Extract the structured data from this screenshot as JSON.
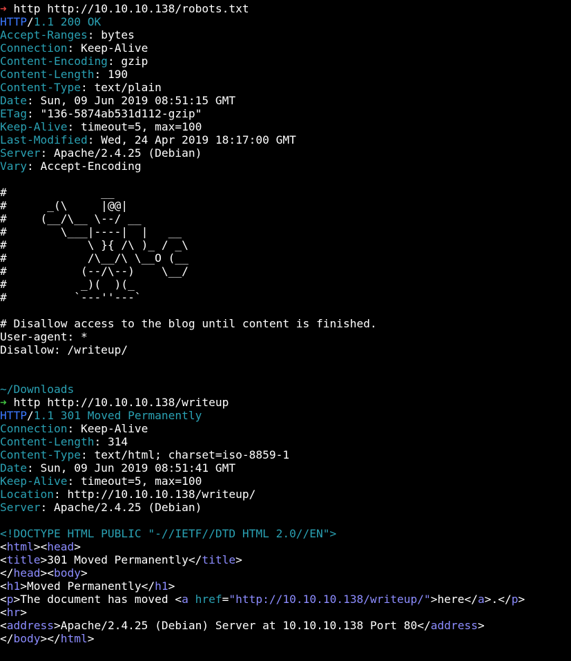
{
  "theme": {
    "background": "#000000",
    "foreground": "#ffffff",
    "blue": "#3b78ff",
    "teal": "#2aa1b3",
    "red_prompt": "#e0433f",
    "green_prompt": "#40c040",
    "purple": "#8c8cff"
  },
  "prompt_icon": "prompt-arrow-icon",
  "lines": [
    {
      "segs": [
        {
          "t": "➜",
          "c": "red"
        },
        {
          "t": " http http://10.10.10.138/robots.txt",
          "c": "white"
        }
      ]
    },
    {
      "segs": [
        {
          "t": "HTTP",
          "c": "blue"
        },
        {
          "t": "/",
          "c": "white"
        },
        {
          "t": "1.1 200 OK",
          "c": "teal"
        }
      ]
    },
    {
      "segs": [
        {
          "t": "Accept-Ranges",
          "c": "teal"
        },
        {
          "t": ": bytes",
          "c": "white"
        }
      ]
    },
    {
      "segs": [
        {
          "t": "Connection",
          "c": "teal"
        },
        {
          "t": ": Keep-Alive",
          "c": "white"
        }
      ]
    },
    {
      "segs": [
        {
          "t": "Content-Encoding",
          "c": "teal"
        },
        {
          "t": ": gzip",
          "c": "white"
        }
      ]
    },
    {
      "segs": [
        {
          "t": "Content-Length",
          "c": "teal"
        },
        {
          "t": ": 190",
          "c": "white"
        }
      ]
    },
    {
      "segs": [
        {
          "t": "Content-Type",
          "c": "teal"
        },
        {
          "t": ": text/plain",
          "c": "white"
        }
      ]
    },
    {
      "segs": [
        {
          "t": "Date",
          "c": "teal"
        },
        {
          "t": ": Sun, 09 Jun 2019 08:51:15 GMT",
          "c": "white"
        }
      ]
    },
    {
      "segs": [
        {
          "t": "ETag",
          "c": "teal"
        },
        {
          "t": ": \"136-5874ab531d112-gzip\"",
          "c": "white"
        }
      ]
    },
    {
      "segs": [
        {
          "t": "Keep-Alive",
          "c": "teal"
        },
        {
          "t": ": timeout=5, max=100",
          "c": "white"
        }
      ]
    },
    {
      "segs": [
        {
          "t": "Last-Modified",
          "c": "teal"
        },
        {
          "t": ": Wed, 24 Apr 2019 18:17:00 GMT",
          "c": "white"
        }
      ]
    },
    {
      "segs": [
        {
          "t": "Server",
          "c": "teal"
        },
        {
          "t": ": Apache/2.4.25 (Debian)",
          "c": "white"
        }
      ]
    },
    {
      "segs": [
        {
          "t": "Vary",
          "c": "teal"
        },
        {
          "t": ": Accept-Encoding",
          "c": "white"
        }
      ]
    },
    {
      "segs": []
    },
    {
      "segs": [
        {
          "t": "#              __",
          "c": "white"
        }
      ]
    },
    {
      "segs": [
        {
          "t": "#      _(\\     |@@|",
          "c": "white"
        }
      ]
    },
    {
      "segs": [
        {
          "t": "#     (__/\\__ \\--/ __",
          "c": "white"
        }
      ]
    },
    {
      "segs": [
        {
          "t": "#        \\___|----|  |   __",
          "c": "white"
        }
      ]
    },
    {
      "segs": [
        {
          "t": "#            \\ }{ /\\ )_ / _\\",
          "c": "white"
        }
      ]
    },
    {
      "segs": [
        {
          "t": "#            /\\__/\\ \\__O (__",
          "c": "white"
        }
      ]
    },
    {
      "segs": [
        {
          "t": "#           (--/\\--)    \\__/",
          "c": "white"
        }
      ]
    },
    {
      "segs": [
        {
          "t": "#           _)(  )(_",
          "c": "white"
        }
      ]
    },
    {
      "segs": [
        {
          "t": "#          `---''---`",
          "c": "white"
        }
      ]
    },
    {
      "segs": []
    },
    {
      "segs": [
        {
          "t": "# Disallow access to the blog until content is finished.",
          "c": "white"
        }
      ]
    },
    {
      "segs": [
        {
          "t": "User-agent: *",
          "c": "white"
        }
      ]
    },
    {
      "segs": [
        {
          "t": "Disallow: /writeup/",
          "c": "white"
        }
      ]
    },
    {
      "segs": []
    },
    {
      "segs": []
    },
    {
      "segs": [
        {
          "t": "~/Downloads",
          "c": "teal"
        }
      ]
    },
    {
      "segs": [
        {
          "t": "➜",
          "c": "green"
        },
        {
          "t": " http http://10.10.10.138/writeup",
          "c": "white"
        }
      ]
    },
    {
      "segs": [
        {
          "t": "HTTP",
          "c": "blue"
        },
        {
          "t": "/",
          "c": "white"
        },
        {
          "t": "1.1 301 Moved Permanently",
          "c": "teal"
        }
      ]
    },
    {
      "segs": [
        {
          "t": "Connection",
          "c": "teal"
        },
        {
          "t": ": Keep-Alive",
          "c": "white"
        }
      ]
    },
    {
      "segs": [
        {
          "t": "Content-Length",
          "c": "teal"
        },
        {
          "t": ": 314",
          "c": "white"
        }
      ]
    },
    {
      "segs": [
        {
          "t": "Content-Type",
          "c": "teal"
        },
        {
          "t": ": text/html; charset=iso-8859-1",
          "c": "white"
        }
      ]
    },
    {
      "segs": [
        {
          "t": "Date",
          "c": "teal"
        },
        {
          "t": ": Sun, 09 Jun 2019 08:51:41 GMT",
          "c": "white"
        }
      ]
    },
    {
      "segs": [
        {
          "t": "Keep-Alive",
          "c": "teal"
        },
        {
          "t": ": timeout=5, max=100",
          "c": "white"
        }
      ]
    },
    {
      "segs": [
        {
          "t": "Location",
          "c": "teal"
        },
        {
          "t": ": http://10.10.10.138/writeup/",
          "c": "white"
        }
      ]
    },
    {
      "segs": [
        {
          "t": "Server",
          "c": "teal"
        },
        {
          "t": ": Apache/2.4.25 (Debian)",
          "c": "white"
        }
      ]
    },
    {
      "segs": []
    },
    {
      "segs": [
        {
          "t": "<!DOCTYPE HTML PUBLIC \"-//IETF//DTD HTML 2.0//EN\">",
          "c": "teal"
        }
      ]
    },
    {
      "segs": [
        {
          "t": "<",
          "c": "white"
        },
        {
          "t": "html",
          "c": "purple"
        },
        {
          "t": "><",
          "c": "white"
        },
        {
          "t": "head",
          "c": "purple"
        },
        {
          "t": ">",
          "c": "white"
        }
      ]
    },
    {
      "segs": [
        {
          "t": "<",
          "c": "white"
        },
        {
          "t": "title",
          "c": "purple"
        },
        {
          "t": ">301 Moved Permanently</",
          "c": "white"
        },
        {
          "t": "title",
          "c": "purple"
        },
        {
          "t": ">",
          "c": "white"
        }
      ]
    },
    {
      "segs": [
        {
          "t": "</",
          "c": "white"
        },
        {
          "t": "head",
          "c": "purple"
        },
        {
          "t": "><",
          "c": "white"
        },
        {
          "t": "body",
          "c": "purple"
        },
        {
          "t": ">",
          "c": "white"
        }
      ]
    },
    {
      "segs": [
        {
          "t": "<",
          "c": "white"
        },
        {
          "t": "h1",
          "c": "purple"
        },
        {
          "t": ">Moved Permanently</",
          "c": "white"
        },
        {
          "t": "h1",
          "c": "purple"
        },
        {
          "t": ">",
          "c": "white"
        }
      ]
    },
    {
      "segs": [
        {
          "t": "<",
          "c": "white"
        },
        {
          "t": "p",
          "c": "purple"
        },
        {
          "t": ">The document has moved <",
          "c": "white"
        },
        {
          "t": "a",
          "c": "purple"
        },
        {
          "t": " ",
          "c": "white"
        },
        {
          "t": "href",
          "c": "teal"
        },
        {
          "t": "=",
          "c": "white"
        },
        {
          "t": "\"http://10.10.10.138/writeup/\"",
          "c": "purple"
        },
        {
          "t": ">here</",
          "c": "white"
        },
        {
          "t": "a",
          "c": "purple"
        },
        {
          "t": ">.</",
          "c": "white"
        },
        {
          "t": "p",
          "c": "purple"
        },
        {
          "t": ">",
          "c": "white"
        }
      ]
    },
    {
      "segs": [
        {
          "t": "<",
          "c": "white"
        },
        {
          "t": "hr",
          "c": "purple"
        },
        {
          "t": ">",
          "c": "white"
        }
      ]
    },
    {
      "segs": [
        {
          "t": "<",
          "c": "white"
        },
        {
          "t": "address",
          "c": "purple"
        },
        {
          "t": ">Apache/2.4.25 (Debian) Server at 10.10.10.138 Port 80</",
          "c": "white"
        },
        {
          "t": "address",
          "c": "purple"
        },
        {
          "t": ">",
          "c": "white"
        }
      ]
    },
    {
      "segs": [
        {
          "t": "</",
          "c": "white"
        },
        {
          "t": "body",
          "c": "purple"
        },
        {
          "t": "></",
          "c": "white"
        },
        {
          "t": "html",
          "c": "purple"
        },
        {
          "t": ">",
          "c": "white"
        }
      ]
    }
  ]
}
